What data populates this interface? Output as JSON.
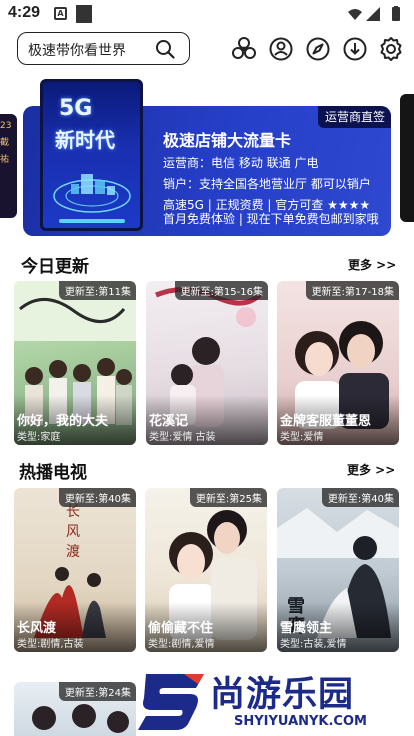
{
  "status_bar": {
    "time": "4:29",
    "notif_letter": "A"
  },
  "search": {
    "placeholder": "极速带你看世界"
  },
  "header_icons": [
    "cube-icon",
    "user-pin-icon",
    "compass-icon",
    "download-icon",
    "settings-icon"
  ],
  "banner": {
    "corner_tag": "运营商直签",
    "title": "极速店铺大流量卡",
    "line1": "运营商：电信 移动 联通 广电",
    "line2": "销户：支持全国各地营业厅 都可以销户",
    "line3": "高速5G | 正规资费 | 官方可查 ★★★★",
    "line4": "首月免费体验 | 现在下单免费包邮到家哦",
    "phone_big1": "5G",
    "phone_big2": "新时代",
    "side_left_text": [
      "23",
      "截",
      "祐"
    ]
  },
  "sections": [
    {
      "title": "今日更新",
      "more": "更多 >>",
      "cards": [
        {
          "badge": "更新至:第11集",
          "title": "你好，我的大夫",
          "type": "类型:家庭"
        },
        {
          "badge": "更新至:第15-16集",
          "title": "花溪记",
          "type": "类型:爱情 古装"
        },
        {
          "badge": "更新至:第17-18集",
          "title": "金牌客服董董恩",
          "type": "类型:爱情"
        }
      ]
    },
    {
      "title": "热播电视",
      "more": "更多 >>",
      "cards": [
        {
          "badge": "更新至:第40集",
          "title": "长风渡",
          "type": "类型:剧情,古装"
        },
        {
          "badge": "更新至:第25集",
          "title": "偷偷藏不住",
          "type": "类型:剧情,爱情"
        },
        {
          "badge": "更新至:第40集",
          "title": "雪鹰领主",
          "type": "类型:古装,爱情"
        }
      ]
    }
  ],
  "partial_card": {
    "badge": "更新至:第24集"
  },
  "watermark": {
    "text": "尚游乐园",
    "url": "SHYIYUANYK.COM"
  },
  "colors": {
    "banner_blue": "#263fc8",
    "watermark_blue": "#1c2a8a"
  }
}
